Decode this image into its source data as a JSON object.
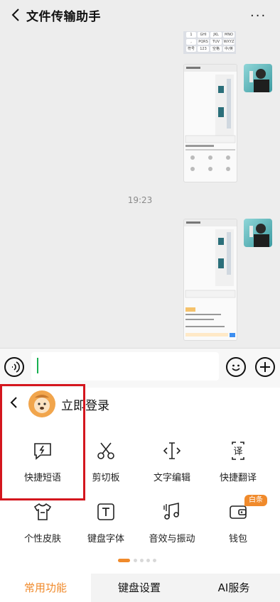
{
  "header": {
    "title": "文件传输助手",
    "more": "···"
  },
  "chat": {
    "timestamp": "19:23",
    "mini_keyboard_keys": [
      "GHI",
      "JKL",
      "MNO",
      "PQRS",
      "TUV",
      "WXYZ",
      "123"
    ],
    "mini_keyboard_labels": [
      "符号",
      "中/英",
      "空格"
    ]
  },
  "input": {
    "value": ""
  },
  "keyboard": {
    "login_label": "立即登录",
    "functions_row1": [
      {
        "label": "快捷短语",
        "icon": "lightning-chat-icon"
      },
      {
        "label": "剪切板",
        "icon": "scissors-icon"
      },
      {
        "label": "文字编辑",
        "icon": "text-cursor-icon"
      },
      {
        "label": "快捷翻译",
        "icon": "translate-icon"
      }
    ],
    "functions_row2": [
      {
        "label": "个性皮肤",
        "icon": "tshirt-icon"
      },
      {
        "label": "键盘字体",
        "icon": "font-t-icon"
      },
      {
        "label": "音效与振动",
        "icon": "music-note-icon"
      },
      {
        "label": "钱包",
        "icon": "wallet-icon"
      }
    ],
    "wallet_badge": "白条",
    "tabs": [
      "常用功能",
      "键盘设置",
      "AI服务"
    ],
    "active_tab": "常用功能",
    "accent_color": "#f08a2b",
    "highlight_color": "#d4161e"
  }
}
